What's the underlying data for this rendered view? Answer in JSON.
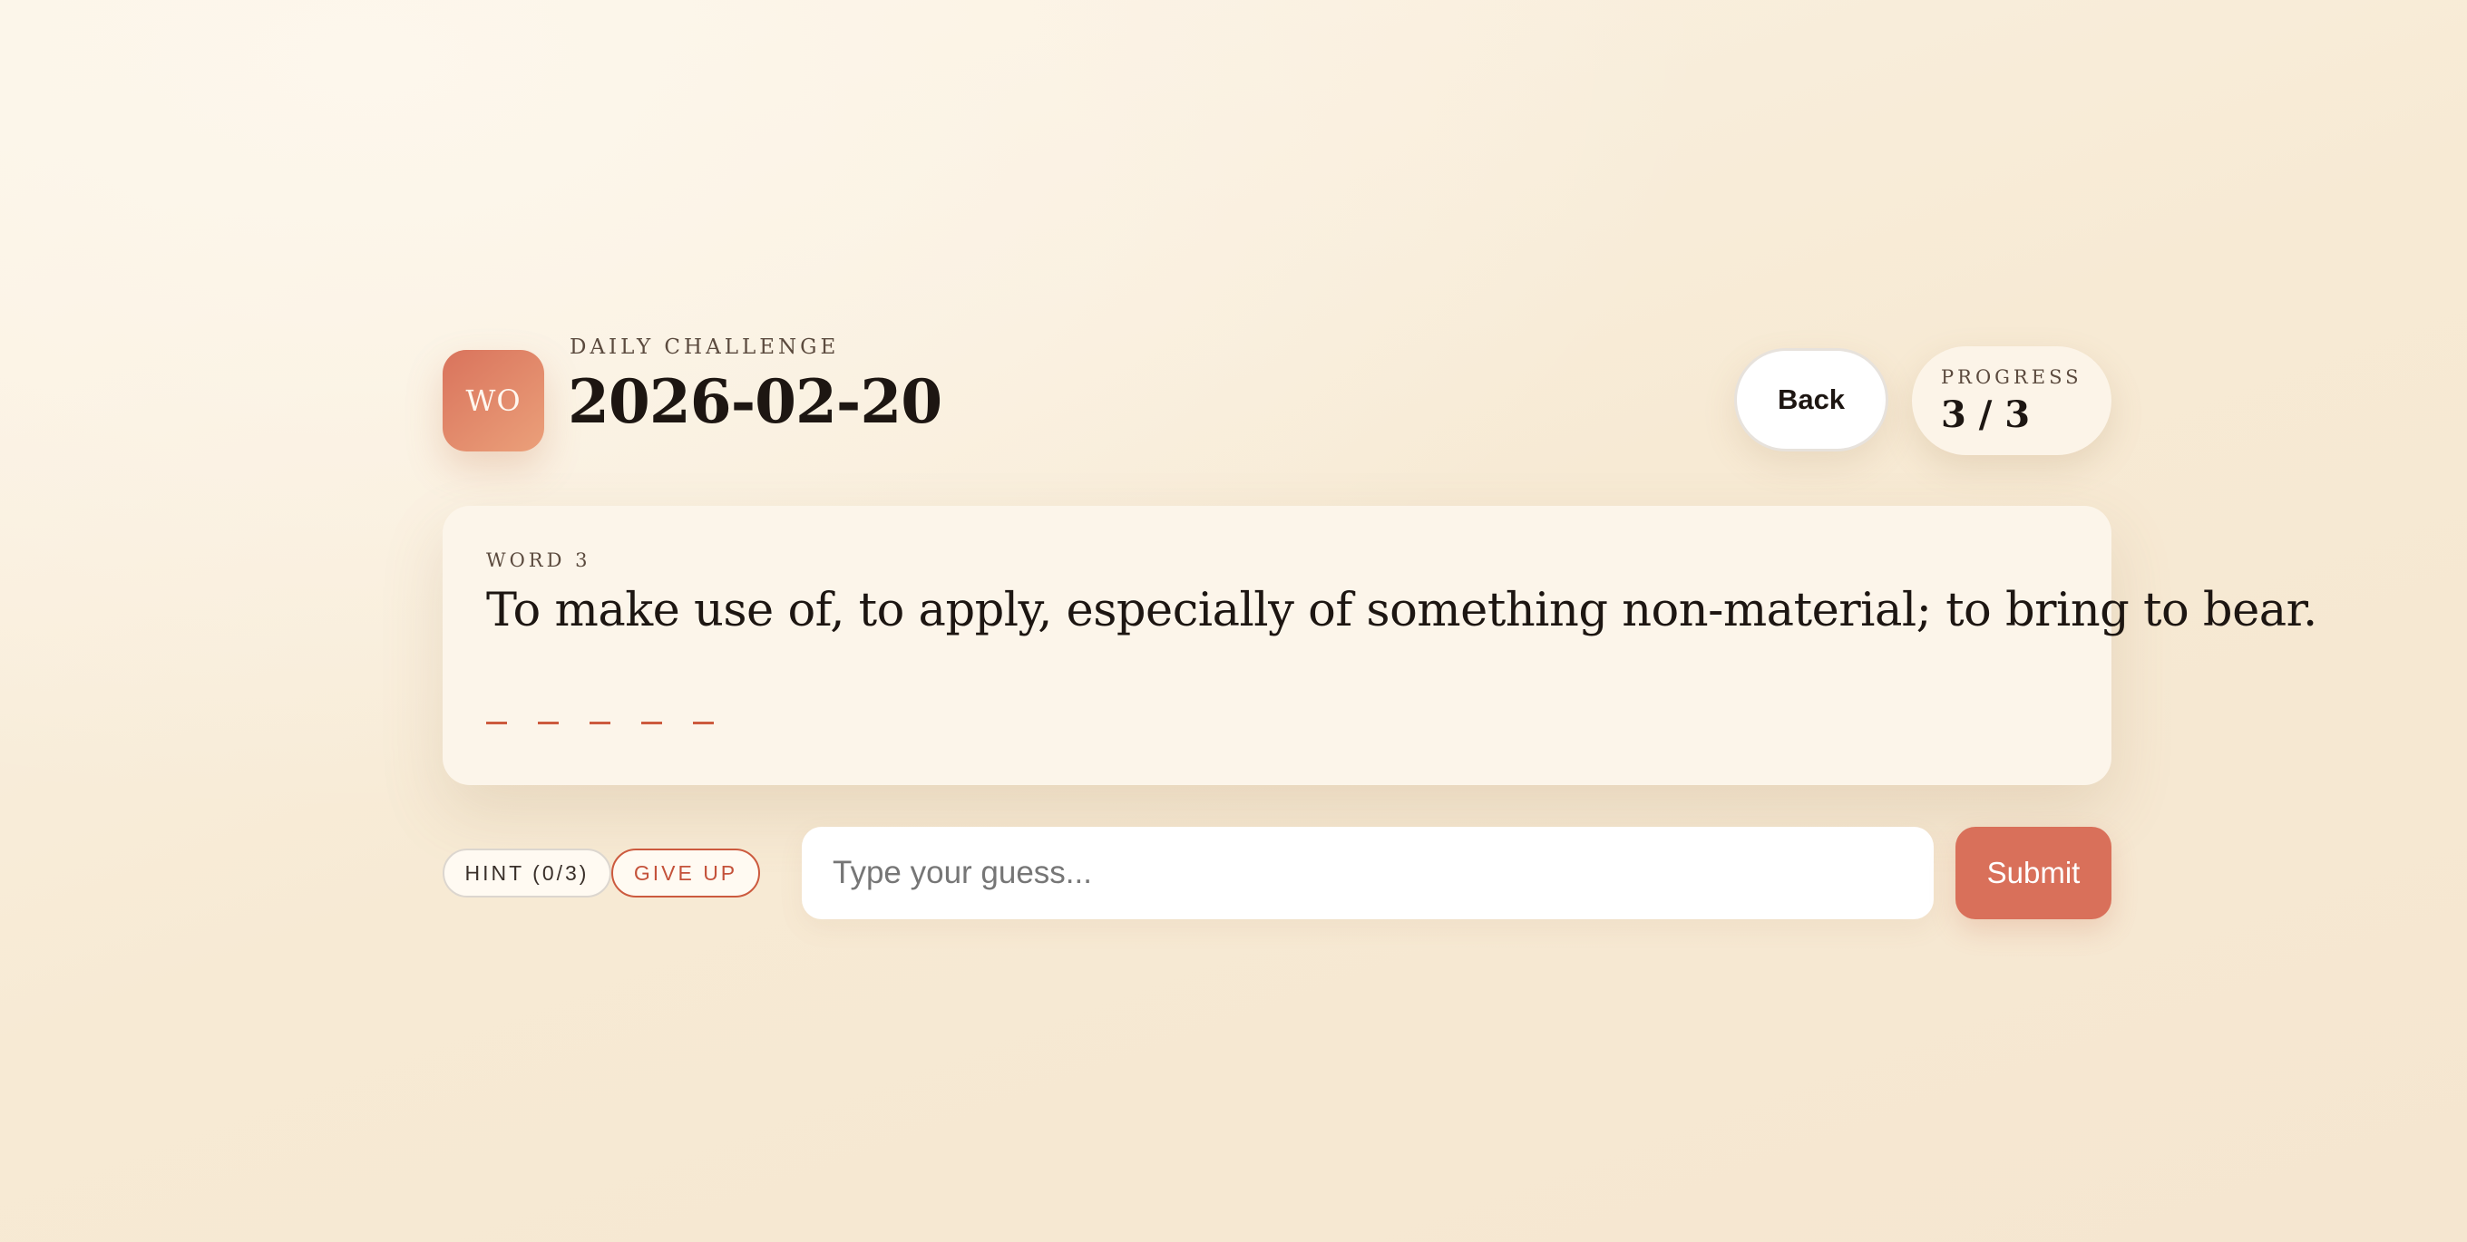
{
  "header": {
    "logo_text": "WO",
    "eyebrow": "DAILY CHALLENGE",
    "date": "2026-02-20",
    "back_label": "Back",
    "progress_label": "PROGRESS",
    "progress_value": "3 / 3"
  },
  "card": {
    "word_label": "WORD 3",
    "definition": "To make use of, to apply, especially of something non-material; to bring to bear.",
    "blanks": [
      "_",
      "_",
      "_",
      "_",
      "_"
    ]
  },
  "controls": {
    "hint_label": "HINT (0/3)",
    "give_up_label": "GIVE UP",
    "guess_placeholder": "Type your guess...",
    "guess_value": "",
    "submit_label": "Submit"
  },
  "colors": {
    "accent": "#d9705a",
    "accent_dark": "#cc5a3e",
    "background": "#f7ead4",
    "card": "#fcf5ea"
  }
}
